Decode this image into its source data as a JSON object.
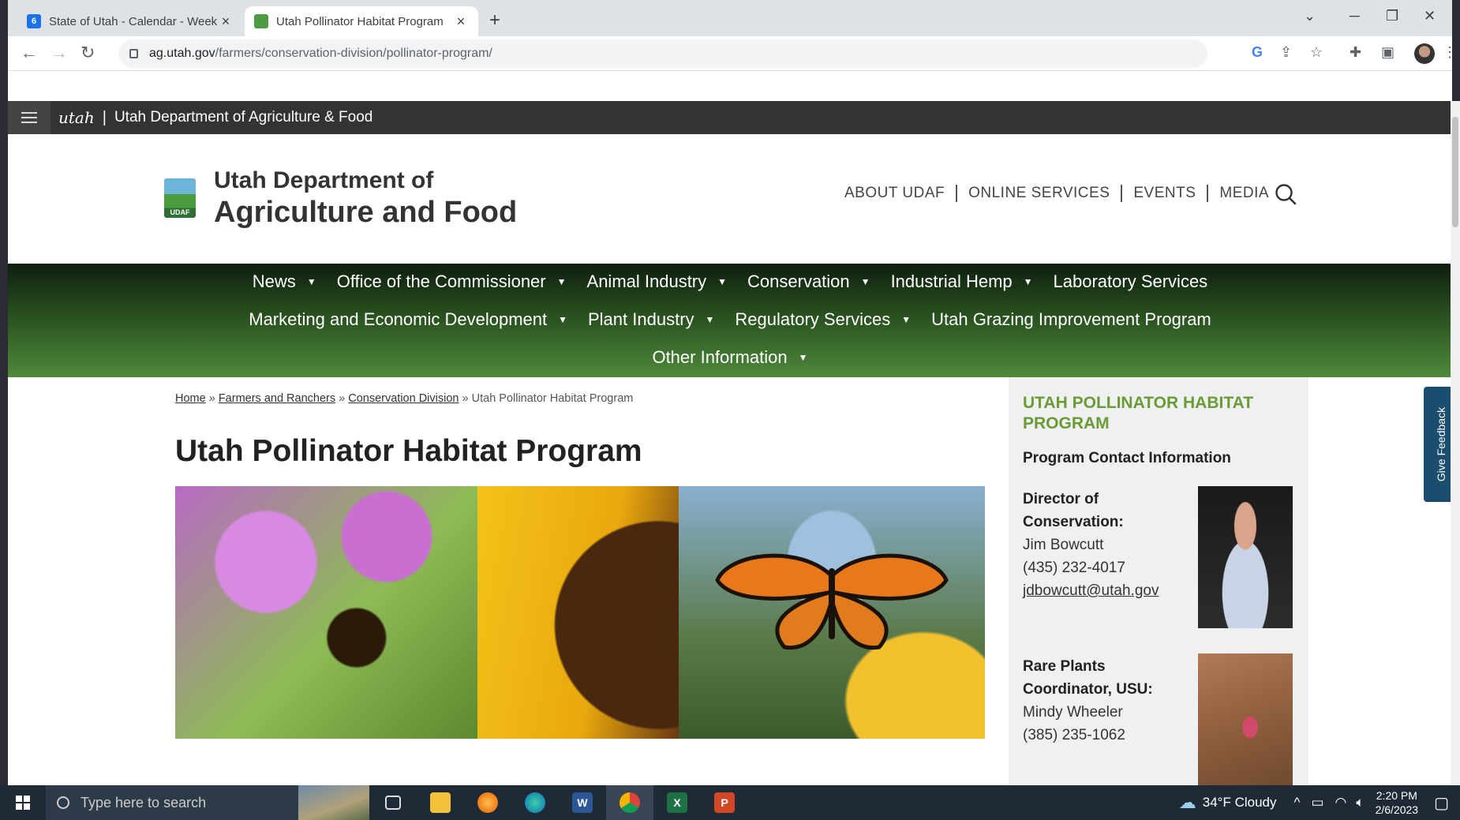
{
  "browser": {
    "tabs": [
      {
        "title": "State of Utah - Calendar - Week o",
        "favicon": "6",
        "active": false
      },
      {
        "title": "Utah Pollinator Habitat Program",
        "active": true
      }
    ],
    "url_host": "ag.utah.gov",
    "url_path": "/farmers/conservation-division/pollinator-program/",
    "new_tab_glyph": "+",
    "close_glyph": "×"
  },
  "govbar": {
    "logo_text": "utah",
    "title": "Utah Department of Agriculture & Food"
  },
  "header": {
    "logo_badge": "UDAF",
    "name_line1": "Utah Department of",
    "name_line2": "Agriculture and Food",
    "top_links": [
      "ABOUT UDAF",
      "ONLINE SERVICES",
      "EVENTS",
      "MEDIA"
    ]
  },
  "nav": {
    "row1": [
      {
        "label": "News",
        "dropdown": true
      },
      {
        "label": "Office of the Commissioner",
        "dropdown": true
      },
      {
        "label": "Animal Industry",
        "dropdown": true
      },
      {
        "label": "Conservation",
        "dropdown": true
      },
      {
        "label": "Industrial Hemp",
        "dropdown": true
      },
      {
        "label": "Laboratory Services",
        "dropdown": false
      }
    ],
    "row2": [
      {
        "label": "Marketing and Economic Development",
        "dropdown": true
      },
      {
        "label": "Plant Industry",
        "dropdown": true
      },
      {
        "label": "Regulatory Services",
        "dropdown": true
      },
      {
        "label": "Utah Grazing Improvement Program",
        "dropdown": false
      }
    ],
    "row3": [
      {
        "label": "Other Information",
        "dropdown": true
      }
    ],
    "caret": "▼"
  },
  "breadcrumb": {
    "items": [
      "Home",
      "Farmers and Ranchers",
      "Conservation Division"
    ],
    "current": "Utah Pollinator Habitat Program",
    "separator": "»"
  },
  "page": {
    "title": "Utah Pollinator Habitat Program"
  },
  "sidebar": {
    "title": "UTAH POLLINATOR HABITAT PROGRAM",
    "subtitle": "Program Contact Information",
    "contacts": [
      {
        "role_line1": "Director of",
        "role_line2": "Conservation:",
        "name": "Jim Bowcutt",
        "phone": "(435) 232-4017",
        "email": "jdbowcutt@utah.gov"
      },
      {
        "role_line1": "Rare Plants",
        "role_line2": "Coordinator, USU:",
        "name": "Mindy Wheeler",
        "phone": "(385) 235-1062"
      }
    ]
  },
  "feedback": {
    "label": "Give Feedback"
  },
  "taskbar": {
    "search_placeholder": "Type here to search",
    "weather": "34°F  Cloudy",
    "time": "2:20 PM",
    "date": "2/6/2023",
    "apps": [
      {
        "name": "word",
        "letter": "W",
        "color": "#2b5797"
      },
      {
        "name": "excel",
        "letter": "X",
        "color": "#1e7145"
      },
      {
        "name": "powerpoint",
        "letter": "P",
        "color": "#d24726"
      }
    ]
  }
}
